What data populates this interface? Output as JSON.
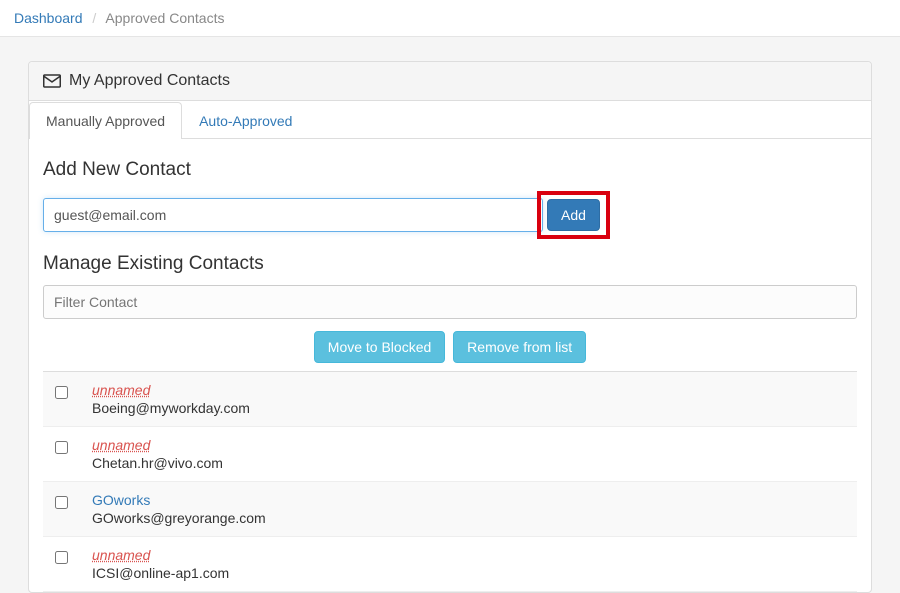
{
  "breadcrumb": {
    "root": "Dashboard",
    "current": "Approved Contacts"
  },
  "panel": {
    "title": "My Approved Contacts"
  },
  "tabs": {
    "manual": "Manually Approved",
    "auto": "Auto-Approved"
  },
  "add_section": {
    "title": "Add New Contact",
    "input_value": "guest@email.com",
    "add_label": "Add"
  },
  "manage_section": {
    "title": "Manage Existing Contacts",
    "filter_placeholder": "Filter Contact",
    "move_label": "Move to Blocked",
    "remove_label": "Remove from list"
  },
  "contacts": [
    {
      "name": "unnamed",
      "email": "Boeing@myworkday.com",
      "is_link": false
    },
    {
      "name": "unnamed",
      "email": "Chetan.hr@vivo.com",
      "is_link": false
    },
    {
      "name": "GOworks",
      "email": "GOworks@greyorange.com",
      "is_link": true
    },
    {
      "name": "unnamed",
      "email": "ICSI@online-ap1.com",
      "is_link": false
    }
  ]
}
